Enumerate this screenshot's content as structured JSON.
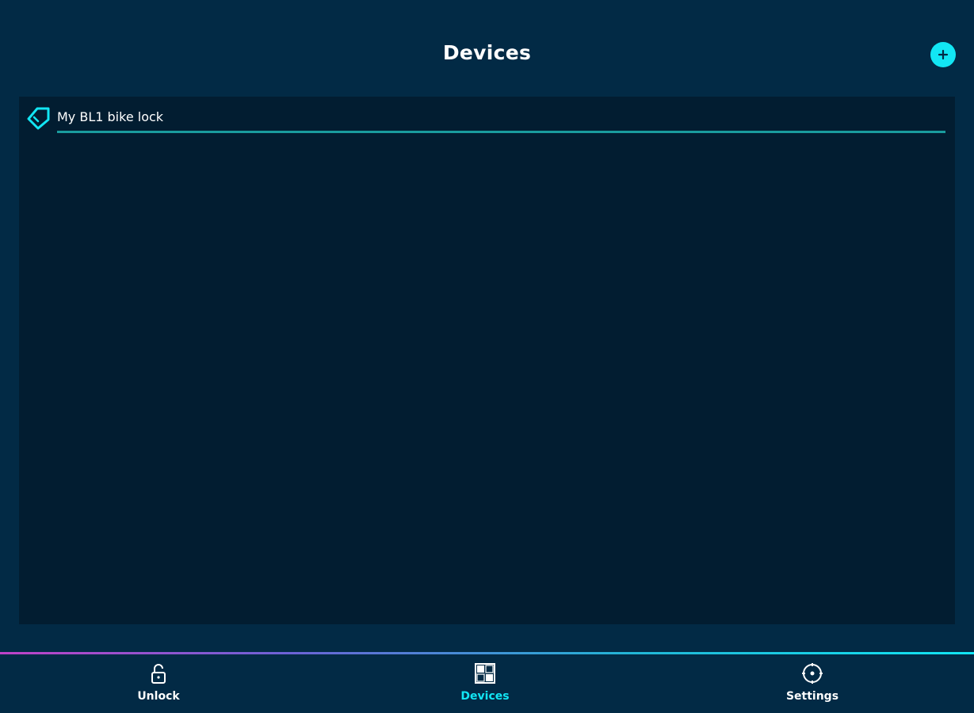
{
  "header": {
    "title": "Devices",
    "add_icon": "plus-icon"
  },
  "devices": [
    {
      "label": "My BL1 bike lock",
      "icon": "tag-icon"
    }
  ],
  "tabbar": {
    "tabs": [
      {
        "label": "Unlock",
        "icon": "lock-open-icon",
        "active": false
      },
      {
        "label": "Devices",
        "icon": "devices-grid-icon",
        "active": true
      },
      {
        "label": "Settings",
        "icon": "settings-icon",
        "active": false
      }
    ]
  },
  "colors": {
    "background": "#022a45",
    "panel": "#021d31",
    "accent": "#12e6f4",
    "underline": "#1a9c9e",
    "divider_gradient_start": "#c042c8",
    "divider_gradient_end": "#12e6f4"
  }
}
